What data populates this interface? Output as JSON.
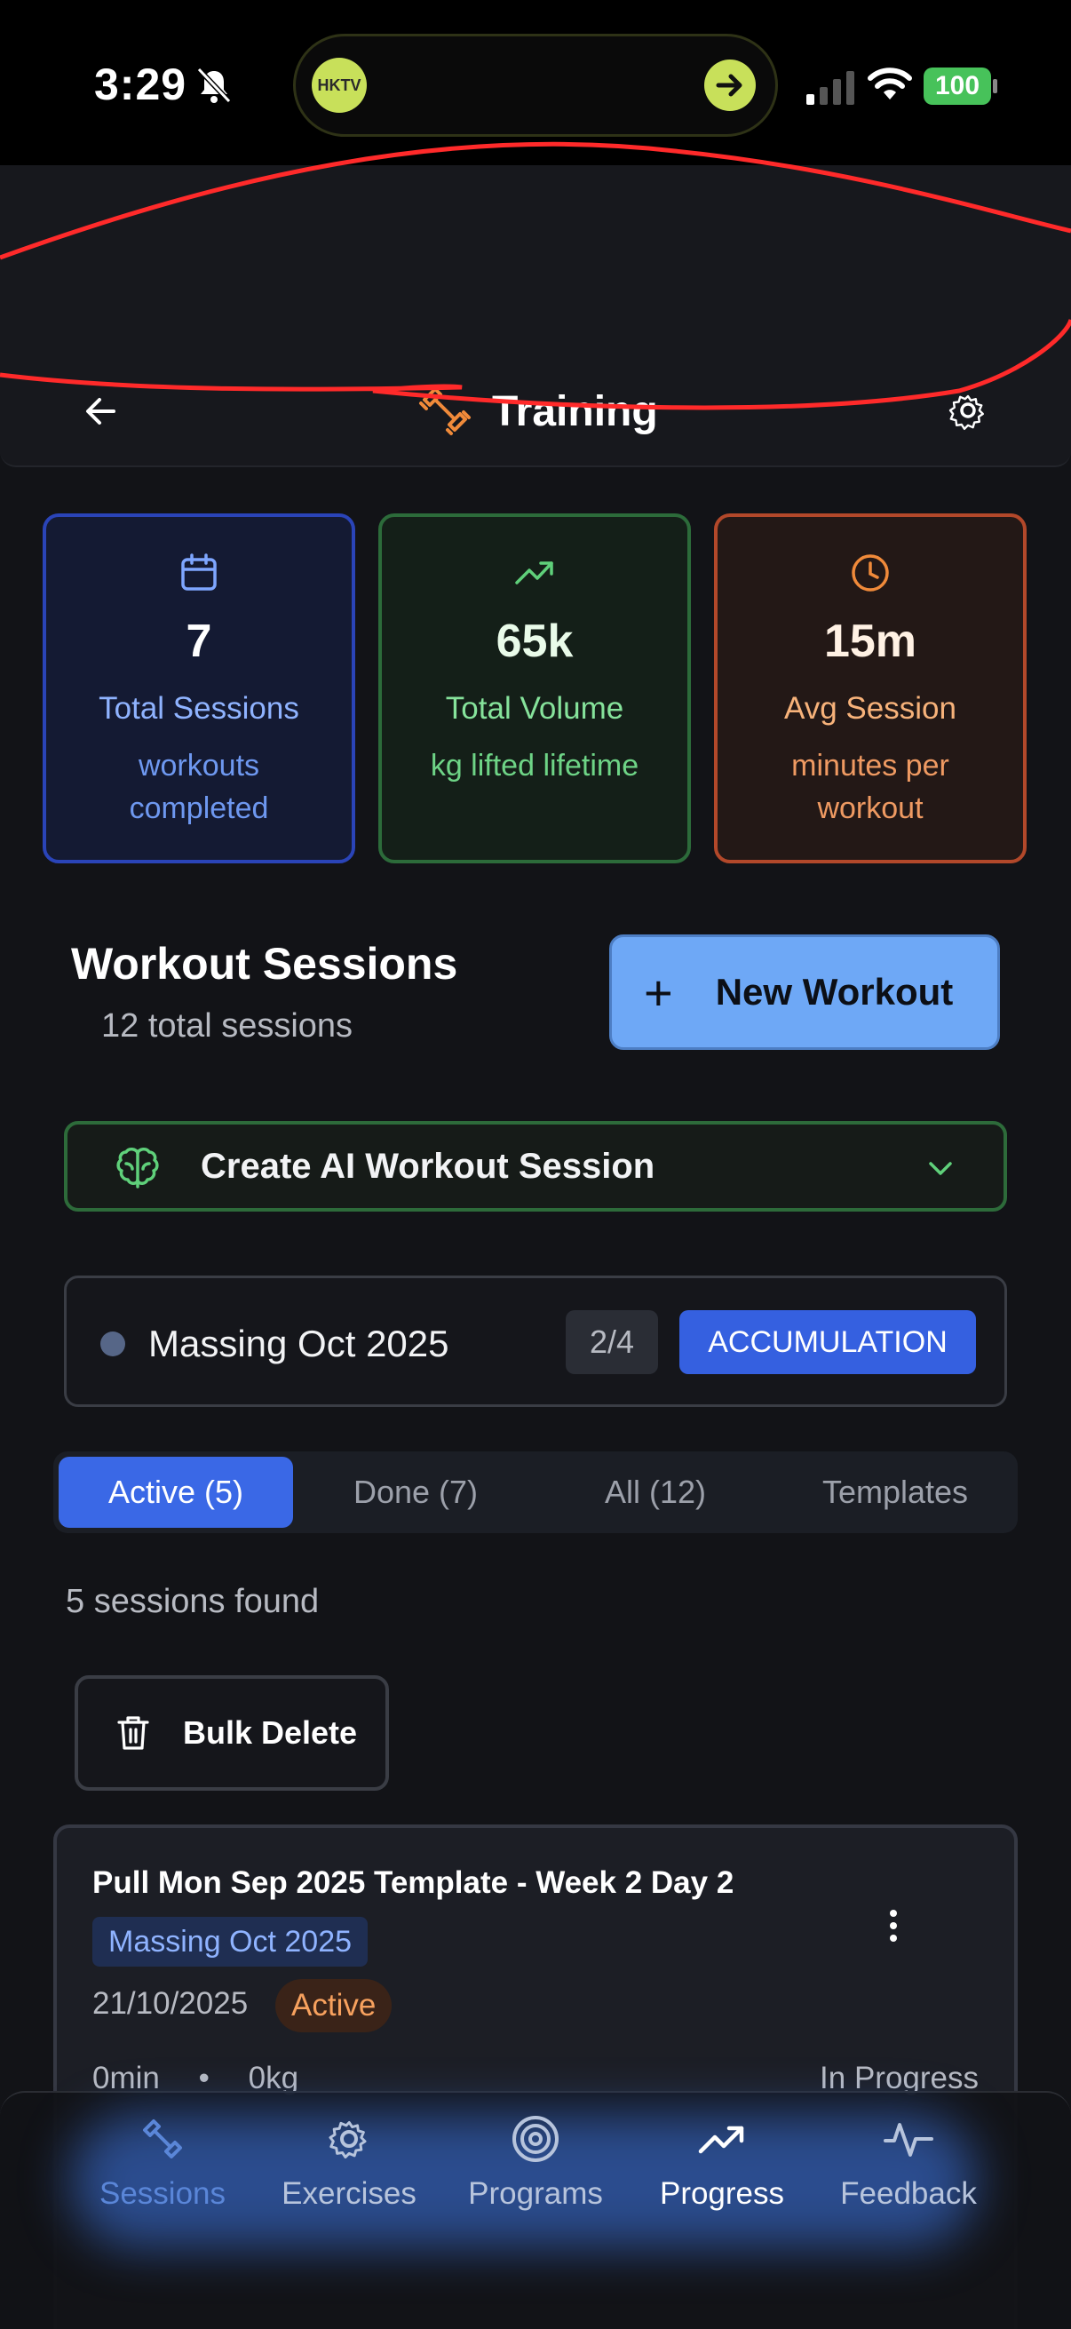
{
  "status_bar": {
    "time": "3:29",
    "battery": "100",
    "island_logo": "HKTV"
  },
  "header": {
    "title": "Training"
  },
  "stats": [
    {
      "icon": "calendar-icon",
      "value": "7",
      "label": "Total Sessions",
      "sub": "workouts completed"
    },
    {
      "icon": "trend-up-icon",
      "value": "65k",
      "label": "Total Volume",
      "sub": "kg lifted lifetime"
    },
    {
      "icon": "clock-icon",
      "value": "15m",
      "label": "Avg Session",
      "sub": "minutes per workout"
    }
  ],
  "sessions": {
    "title": "Workout Sessions",
    "subtitle": "12 total sessions",
    "new_workout_label": "New Workout",
    "new_workout_symbol": "+",
    "ai_label": "Create AI Workout Session",
    "program": {
      "name": "Massing Oct 2025",
      "week": "2/4",
      "phase": "ACCUMULATION"
    },
    "tabs": [
      {
        "label": "Active (5)",
        "active": true
      },
      {
        "label": "Done (7)",
        "active": false
      },
      {
        "label": "All (12)",
        "active": false
      },
      {
        "label": "Templates",
        "active": false
      }
    ],
    "found_text": "5 sessions found",
    "bulk_delete_label": "Bulk Delete",
    "cards": [
      {
        "title": "Pull Mon Sep 2025 Template - Week 2 Day 2",
        "program": "Massing Oct 2025",
        "date": "21/10/2025",
        "status": "Active",
        "duration": "0min",
        "separator": "•",
        "volume": "0kg",
        "progress": "In Progress"
      }
    ]
  },
  "nav": [
    {
      "label": "Sessions",
      "icon": "dumbbell-icon"
    },
    {
      "label": "Exercises",
      "icon": "gear-icon"
    },
    {
      "label": "Programs",
      "icon": "target-icon"
    },
    {
      "label": "Progress",
      "icon": "trend-up-icon"
    },
    {
      "label": "Feedback",
      "icon": "activity-icon"
    }
  ],
  "colors": {
    "background": "#121317",
    "accent_blue": "#3a68e6",
    "new_workout": "#6ea8f6",
    "green_border": "#2d6b3a",
    "orange_border": "#b2482a",
    "annotation_red": "#ff2a2a"
  }
}
